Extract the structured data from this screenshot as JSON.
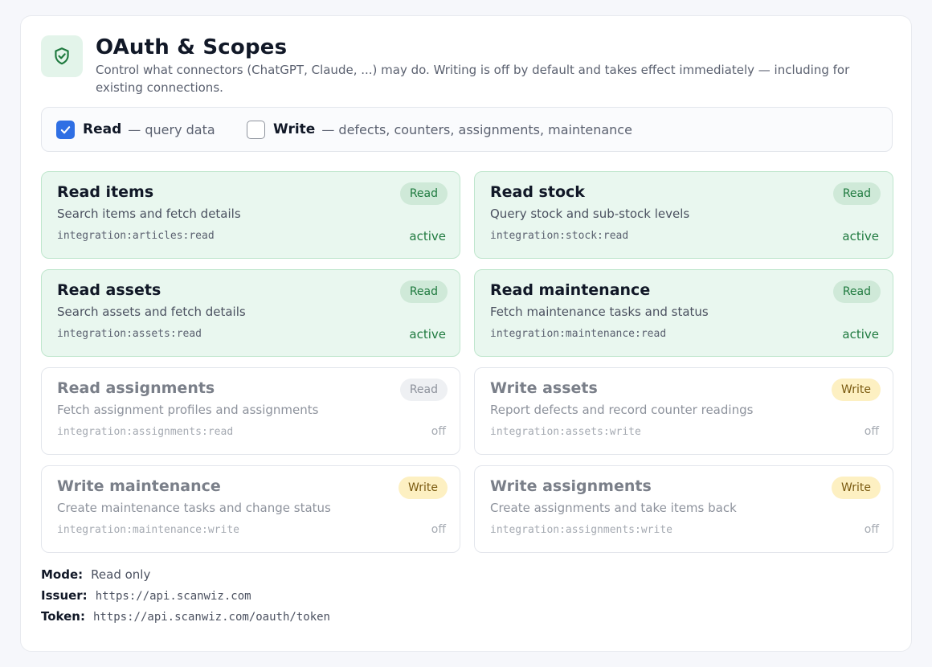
{
  "header": {
    "title": "OAuth & Scopes",
    "subtitle": "Control what connectors (ChatGPT, Claude, ...) may do. Writing is off by default and takes effect immediately — including for existing connections.",
    "icon": "shield-check-icon"
  },
  "toggles": {
    "read": {
      "label": "Read",
      "desc": "— query data",
      "checked": true
    },
    "write": {
      "label": "Write",
      "desc": "— defects, counters, assignments, maintenance",
      "checked": false
    }
  },
  "scopes": [
    {
      "title": "Read items",
      "desc": "Search items and fetch details",
      "scope": "integration:articles:read",
      "badge": "Read",
      "status": "active"
    },
    {
      "title": "Read stock",
      "desc": "Query stock and sub-stock levels",
      "scope": "integration:stock:read",
      "badge": "Read",
      "status": "active"
    },
    {
      "title": "Read assets",
      "desc": "Search assets and fetch details",
      "scope": "integration:assets:read",
      "badge": "Read",
      "status": "active"
    },
    {
      "title": "Read maintenance",
      "desc": "Fetch maintenance tasks and status",
      "scope": "integration:maintenance:read",
      "badge": "Read",
      "status": "active"
    },
    {
      "title": "Read assignments",
      "desc": "Fetch assignment profiles and assignments",
      "scope": "integration:assignments:read",
      "badge": "Read",
      "status": "off"
    },
    {
      "title": "Write assets",
      "desc": "Report defects and record counter readings",
      "scope": "integration:assets:write",
      "badge": "Write",
      "status": "off"
    },
    {
      "title": "Write maintenance",
      "desc": "Create maintenance tasks and change status",
      "scope": "integration:maintenance:write",
      "badge": "Write",
      "status": "off"
    },
    {
      "title": "Write assignments",
      "desc": "Create assignments and take items back",
      "scope": "integration:assignments:write",
      "badge": "Write",
      "status": "off"
    }
  ],
  "info": {
    "mode_label": "Mode:",
    "mode_value": "Read only",
    "issuer_label": "Issuer:",
    "issuer_value": "https://api.scanwiz.com",
    "token_label": "Token:",
    "token_value": "https://api.scanwiz.com/oauth/token"
  },
  "colors": {
    "accent": "#2f6fe4",
    "active_bg": "#e9f7ef",
    "active_text": "#1f7a3f",
    "write_badge_bg": "#fdf0c2"
  }
}
